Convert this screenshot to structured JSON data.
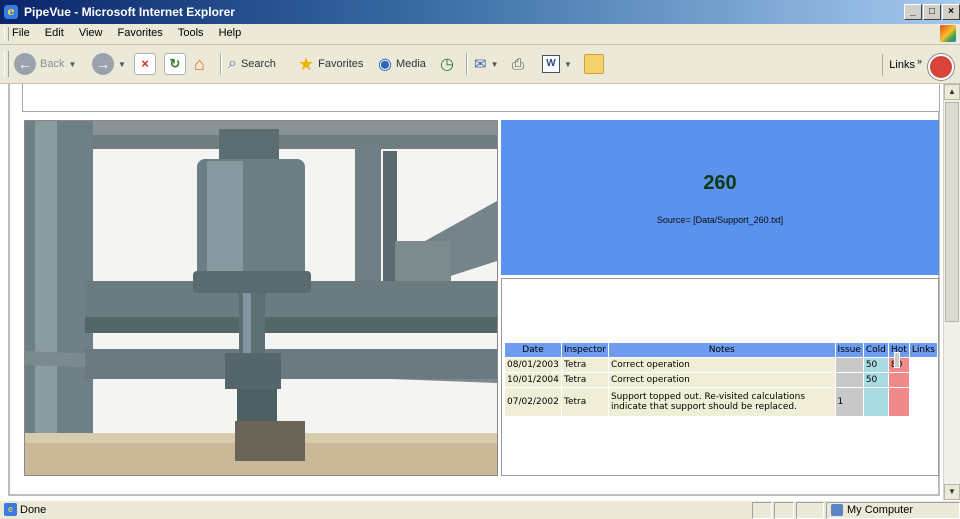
{
  "window": {
    "title": "PipeVue - Microsoft Internet Explorer"
  },
  "menu": [
    "File",
    "Edit",
    "View",
    "Favorites",
    "Tools",
    "Help"
  ],
  "toolbar": {
    "back": "Back",
    "search": "Search",
    "favorites": "Favorites",
    "media": "Media",
    "links": "Links"
  },
  "support": {
    "id": "260",
    "source": "Source= [Data/Support_260.txt]"
  },
  "inspection": {
    "columns": [
      "Date",
      "Inspector",
      "Notes",
      "Issue",
      "Cold",
      "Hot",
      "Links"
    ],
    "rows": [
      {
        "date": "08/01/2003",
        "inspector": "Tetra",
        "notes": "Correct operation",
        "issue": "",
        "cold": "50",
        "hot": "80",
        "links": ""
      },
      {
        "date": "10/01/2004",
        "inspector": "Tetra",
        "notes": "Correct operation",
        "issue": "",
        "cold": "50",
        "hot": "",
        "links": ""
      },
      {
        "date": "07/02/2002",
        "inspector": "Tetra",
        "notes": "Support topped out. Re-visited calculations indicate that support should be replaced.",
        "issue": "1",
        "cold": "",
        "hot": "",
        "links": ""
      }
    ]
  },
  "status": {
    "text": "Done",
    "zone": "My Computer"
  }
}
